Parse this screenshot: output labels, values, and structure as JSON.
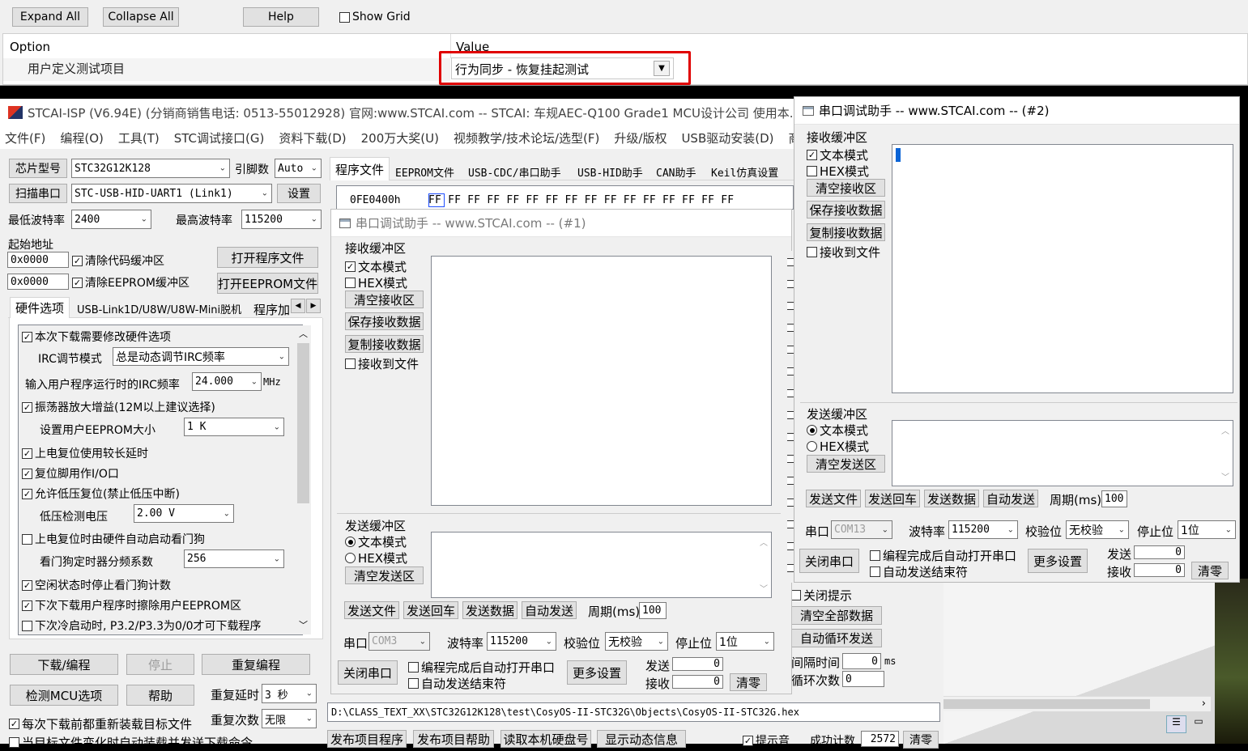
{
  "top_panel": {
    "expand_all": "Expand All",
    "collapse_all": "Collapse All",
    "help": "Help",
    "show_grid": "Show Grid",
    "col_option": "Option",
    "col_value": "Value",
    "row_option": "用户定义测试项目",
    "row_value": "行为同步 - 恢复挂起测试",
    "highlight_color": "#e00000"
  },
  "main_window": {
    "title": "STCAI-ISP (V6.94E) (分销商销售电话: 0513-55012928) 官网:www.STCAI.com  -- STCAI: 车规AEC-Q100 Grade1 MCU设计公司 使用本...",
    "menu": [
      "文件(F)",
      "编程(O)",
      "工具(T)",
      "STC调试接口(G)",
      "资料下载(D)",
      "200万大奖(U)",
      "视频教学/技术论坛/选型(F)",
      "升级/版权",
      "USB驱动安装(D)",
      "商城"
    ],
    "chip_label": "芯片型号",
    "chip_value": "STC32G12K128",
    "pin_label": "引脚数",
    "pin_value": "Auto",
    "scan_port": "扫描串口",
    "port_value": "STC-USB-HID-UART1 (Link1)",
    "settings": "设置",
    "min_baud_label": "最低波特率",
    "min_baud": "2400",
    "max_baud_label": "最高波特率",
    "max_baud": "115200",
    "start_addr": "起始地址",
    "addr1": "0x0000",
    "addr2": "0x0000",
    "clear_code": "清除代码缓冲区",
    "clear_eeprom": "清除EEPROM缓冲区",
    "open_prog": "打开程序文件",
    "open_eeprom": "打开EEPROM文件",
    "left_tabs": [
      "硬件选项",
      "USB-Link1D/U8W/U8W-Mini脱机",
      "程序加"
    ],
    "right_tabs": [
      "程序文件",
      "EEPROM文件",
      "USB-CDC/串口助手",
      "USB-HID助手",
      "CAN助手",
      "Keil仿真设置"
    ],
    "hex_addr": "0FE0400h",
    "hex_bytes": "FF FF FF FF FF FF FF FF FF FF FF FF FF FF FF FF",
    "hw": {
      "modify_hw": "本次下载需要修改硬件选项",
      "irc_mode_label": "IRC调节模式",
      "irc_mode": "总是动态调节IRC频率",
      "irc_freq_label": "输入用户程序运行时的IRC频率",
      "irc_freq": "24.000",
      "mhz": "MHz",
      "osc_gain": "振荡器放大增益(12M以上建议选择)",
      "eeprom_size_label": "设置用户EEPROM大小",
      "eeprom_size": "1   K",
      "power_delay": "上电复位使用较长延时",
      "reset_io": "复位脚用作I/O口",
      "low_volt_reset": "允许低压复位(禁止低压中断)",
      "low_volt_label": "低压检测电压",
      "low_volt": "2.00 V",
      "wdt_auto": "上电复位时由硬件自动启动看门狗",
      "wdt_div_label": "看门狗定时器分频系数",
      "wdt_div": "256",
      "idle_stop_wdt": "空闲状态时停止看门狗计数",
      "erase_eeprom": "下次下载用户程序时擦除用户EEPROM区",
      "cold_boot": "下次冷启动时, P3.2/P3.3为0/0才可下载程序"
    },
    "download": "下载/编程",
    "stop": "停止",
    "reprogram": "重复编程",
    "check_mcu": "检测MCU选项",
    "help": "帮助",
    "repeat_delay_label": "重复延时",
    "repeat_delay": "3 秒",
    "repeat_count_label": "重复次数",
    "repeat_count": "无限",
    "reload_each": "每次下载前都重新装载目标文件",
    "auto_reload": "当目标文件变化时自动装载并发送下载命令",
    "file_path": "D:\\CLASS_TEXT_XX\\STC32G12K128\\test\\CosyOS-II-STC32G\\Objects\\CosyOS-II-STC32G.hex",
    "bottom_buttons": [
      "发布项目程序",
      "发布项目帮助",
      "读取本机硬盘号",
      "显示动态信息"
    ],
    "tip_sound": "提示音",
    "success_count_label": "成功计数",
    "success_count": "2572",
    "clear": "清零",
    "close_tip": "关闭提示",
    "clear_all": "清空全部数据",
    "auto_loop": "自动循环发送",
    "interval_label": "间隔时间",
    "interval": "0",
    "ms": "ms",
    "loop_count_label": "循环次数",
    "loop_count": "0"
  },
  "serial1": {
    "title": "串口调试助手 -- www.STCAI.com -- (#1)",
    "recv_group": "接收缓冲区",
    "text_mode": "文本模式",
    "hex_mode": "HEX模式",
    "clear_recv": "清空接收区",
    "save_recv": "保存接收数据",
    "copy_recv": "复制接收数据",
    "recv_to_file": "接收到文件",
    "send_group": "发送缓冲区",
    "clear_send": "清空发送区",
    "send_file": "发送文件",
    "send_cr": "发送回车",
    "send_data": "发送数据",
    "auto_send": "自动发送",
    "period_label": "周期(ms)",
    "period": "100",
    "port_label": "串口",
    "port": "COM3",
    "baud_label": "波特率",
    "baud": "115200",
    "parity_label": "校验位",
    "parity": "无校验",
    "stop_label": "停止位",
    "stopbits": "1位",
    "close_port": "关闭串口",
    "auto_open": "编程完成后自动打开串口",
    "auto_send_end": "自动发送结束符",
    "more": "更多设置",
    "tx_label": "发送",
    "tx": "0",
    "rx_label": "接收",
    "rx": "0",
    "clear": "清零"
  },
  "serial2": {
    "title": "串口调试助手 -- www.STCAI.com -- (#2)",
    "recv_group": "接收缓冲区",
    "text_mode": "文本模式",
    "hex_mode": "HEX模式",
    "clear_recv": "清空接收区",
    "save_recv": "保存接收数据",
    "copy_recv": "复制接收数据",
    "recv_to_file": "接收到文件",
    "send_group": "发送缓冲区",
    "clear_send": "清空发送区",
    "send_file": "发送文件",
    "send_cr": "发送回车",
    "send_data": "发送数据",
    "auto_send": "自动发送",
    "period_label": "周期(ms)",
    "period": "100",
    "port_label": "串口",
    "port": "COM13",
    "baud_label": "波特率",
    "baud": "115200",
    "parity_label": "校验位",
    "parity": "无校验",
    "stop_label": "停止位",
    "stopbits": "1位",
    "close_port": "关闭串口",
    "auto_open": "编程完成后自动打开串口",
    "auto_send_end": "自动发送结束符",
    "more": "更多设置",
    "tx_label": "发送",
    "tx": "0",
    "rx_label": "接收",
    "rx": "0",
    "clear": "清零"
  }
}
